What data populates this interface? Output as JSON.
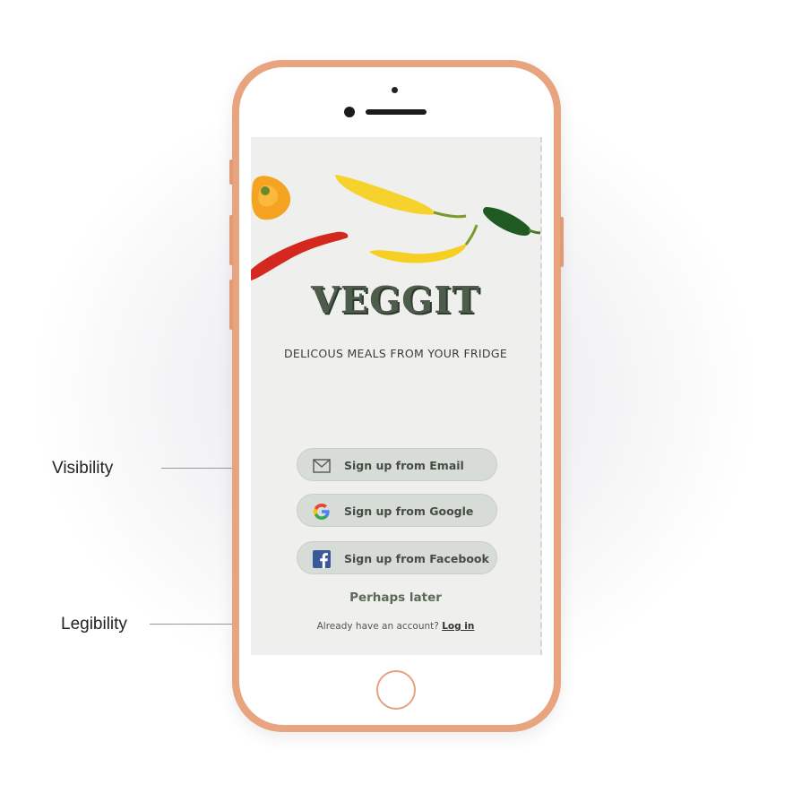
{
  "annotations": {
    "visibility": "Visibility",
    "legibility": "Legibility"
  },
  "app": {
    "logo": "VEGGIT",
    "tagline": "DELICOUS MEALS FROM YOUR FRIDGE"
  },
  "buttons": {
    "email": {
      "label": "Sign up from Email",
      "icon": "mail-icon"
    },
    "google": {
      "label": "Sign up from Google",
      "icon": "google-icon"
    },
    "facebook": {
      "label": "Sign up from Facebook",
      "icon": "facebook-icon"
    }
  },
  "later": "Perhaps later",
  "account": {
    "prompt": "Already have an account?",
    "login": "Log in"
  },
  "colors": {
    "phone_frame": "#e8a37f",
    "logo": "#4e5d4b",
    "button_bg": "#d7dcd7",
    "google_blue": "#4285F4",
    "facebook_blue": "#3b5998"
  }
}
